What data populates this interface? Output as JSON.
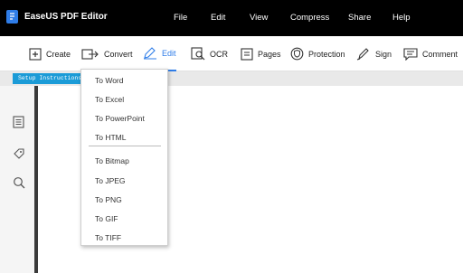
{
  "app": {
    "title": "EaseUS PDF Editor"
  },
  "menubar": {
    "items": [
      "File",
      "Edit",
      "View",
      "Compress",
      "Share",
      "Help"
    ]
  },
  "toolbar": {
    "tools": [
      {
        "label": "Create",
        "icon": "plus-box-icon"
      },
      {
        "label": "Convert",
        "icon": "convert-icon"
      },
      {
        "label": "Edit",
        "icon": "edit-pencil-icon",
        "active": true
      },
      {
        "label": "OCR",
        "icon": "ocr-icon"
      },
      {
        "label": "Pages",
        "icon": "pages-icon"
      },
      {
        "label": "Protection",
        "icon": "shield-icon"
      },
      {
        "label": "Sign",
        "icon": "pen-icon"
      },
      {
        "label": "Comment",
        "icon": "comment-icon"
      }
    ]
  },
  "document": {
    "tab_title": "Setup Instructions -…"
  },
  "sidepanel": {
    "icons": [
      "thumbnails-icon",
      "bookmark-tag-icon",
      "search-icon"
    ]
  },
  "convert_menu": {
    "items": [
      "To Word",
      "To Excel",
      "To PowerPoint",
      "To HTML",
      "To Bitmap",
      "To JPEG",
      "To PNG",
      "To GIF",
      "To TIFF"
    ]
  },
  "colors": {
    "titlebar_bg": "#000000",
    "accent": "#2f7de8",
    "tab_bg": "#1b9bd7"
  }
}
